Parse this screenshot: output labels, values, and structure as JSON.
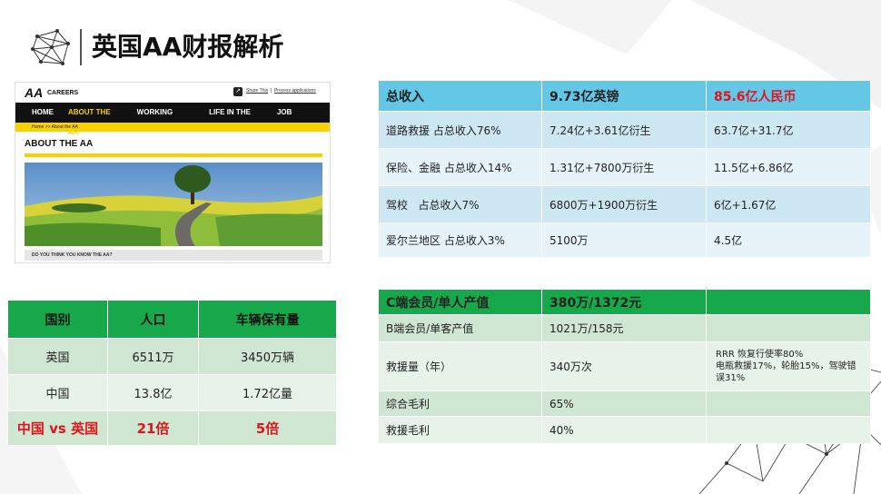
{
  "title": "英国AA财报解析",
  "aa_site": {
    "logo": "AA",
    "brand": "CAREERS",
    "top_links": [
      "Share This",
      "Process applications"
    ],
    "nav": [
      "HOME",
      "ABOUT THE AA",
      "WORKING HERE",
      "LIFE IN THE AA",
      "JOB SEARCH"
    ],
    "breadcrumb": "Home  >>  About the AA",
    "heading": "ABOUT THE AA",
    "question": "DO YOU THINK YOU KNOW THE AA?",
    "colors": {
      "accent": "#f7d100",
      "nav_bg": "#111111"
    }
  },
  "country_table": {
    "headers": [
      "国别",
      "人口",
      "车辆保有量"
    ],
    "rows": [
      [
        "英国",
        "6511万",
        "3450万辆"
      ],
      [
        "中国",
        "13.8亿",
        "1.72亿量"
      ],
      [
        "中国 vs 英国",
        "21倍",
        "5倍"
      ]
    ]
  },
  "revenue_table": {
    "headers": [
      "总收入",
      "9.73亿英镑",
      "85.6亿人民币"
    ],
    "rows": [
      [
        "道路救援 占总收入76%",
        "7.24亿+3.61亿衍生",
        "63.7亿+31.7亿"
      ],
      [
        "保险、金融 占总收入14%",
        "1.31亿+7800万衍生",
        "11.5亿+6.86亿"
      ],
      [
        "驾校   占总收入7%",
        "6800万+1900万衍生",
        "6亿+1.67亿"
      ],
      [
        "爱尔兰地区  占总收入3%",
        "5100万",
        "4.5亿"
      ]
    ]
  },
  "member_table": {
    "headers": [
      "C端会员/单人产值",
      "380万/1372元",
      ""
    ],
    "rows": [
      [
        "B端会员/单客产值",
        "1021万/158元",
        ""
      ],
      [
        "救援量（年）",
        "340万次",
        "RRR 恢复行使率80%\n电瓶救援17%，轮胎15%，驾驶错误31%"
      ],
      [
        "综合毛利",
        "65%",
        ""
      ],
      [
        "救援毛利",
        "40%",
        ""
      ]
    ]
  },
  "colors": {
    "green_header": "#16a84a",
    "blue_header": "#64c7e6",
    "highlight_red": "#e0141b"
  }
}
